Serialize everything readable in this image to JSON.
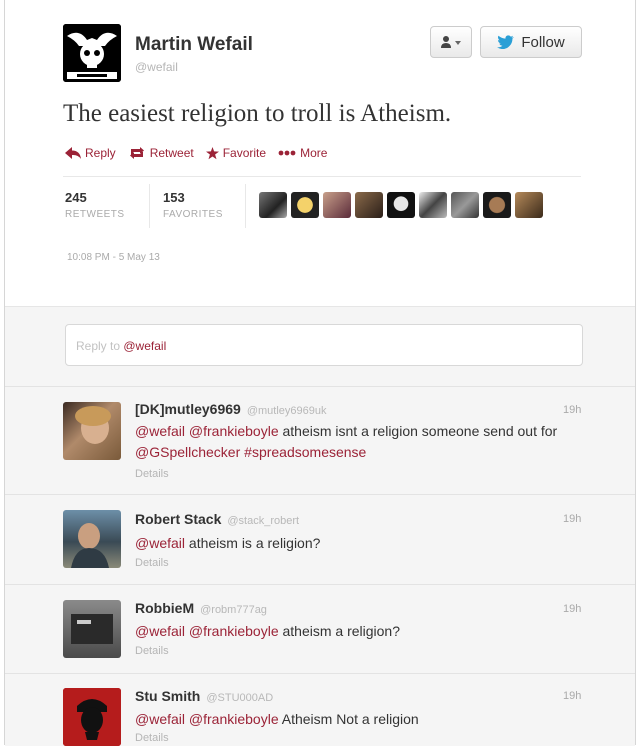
{
  "tweet": {
    "author_name": "Martin Wefail",
    "author_handle": "@wefail",
    "text": "The easiest religion to troll is Atheism.",
    "follow_label": "Follow",
    "user_menu_label": "↓▾",
    "actions": {
      "reply": "Reply",
      "retweet": "Retweet",
      "favorite": "Favorite",
      "more": "More"
    },
    "stats": {
      "retweets_count": "245",
      "retweets_label": "RETWEETS",
      "favorites_count": "153",
      "favorites_label": "FAVORITES"
    },
    "timestamp": "10:08 PM - 5 May 13"
  },
  "reply_box": {
    "placeholder": "Reply to",
    "mention": "@wefail"
  },
  "replies": [
    {
      "name": "[DK]mutley6969",
      "handle": "@mutley6969uk",
      "time": "19h",
      "mention1": "@wefail",
      "mention2": "@frankieboyle",
      "text1": " atheism isnt a religion  someone send out for ",
      "mention3": "@GSpellchecker",
      "hashtag": "#spreadsomesense",
      "details": "Details"
    },
    {
      "name": "Robert Stack",
      "handle": "@stack_robert",
      "time": "19h",
      "mention1": "@wefail",
      "text1": "  atheism is a religion?",
      "details": "Details"
    },
    {
      "name": "RobbieM",
      "handle": "@robm777ag",
      "time": "19h",
      "mention1": "@wefail",
      "mention2": "@frankieboyle",
      "text1": " atheism a religion?",
      "details": "Details"
    },
    {
      "name": "Stu Smith",
      "handle": "@STU000AD",
      "time": "19h",
      "mention1": "@wefail",
      "mention2": "@frankieboyle",
      "text1": " Atheism  Not a religion",
      "details": "Details"
    }
  ],
  "colors": {
    "accent": "#9b2337",
    "twitter_blue": "#2a9fd6",
    "muted": "#aaaaaa"
  }
}
